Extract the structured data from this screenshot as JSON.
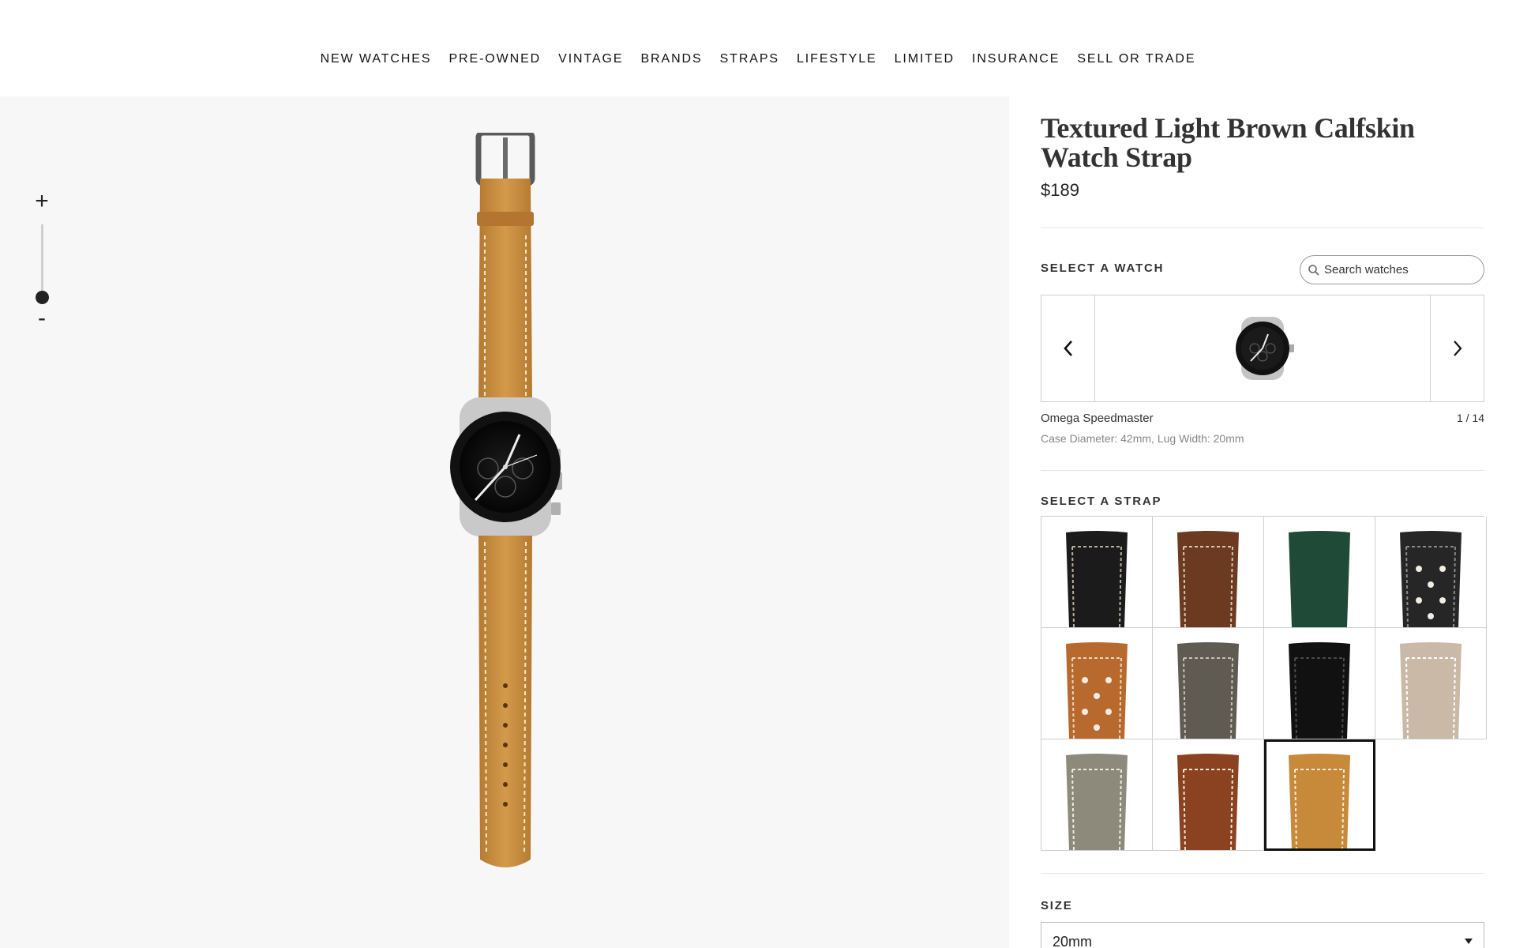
{
  "nav": {
    "items": [
      "NEW WATCHES",
      "PRE-OWNED",
      "VINTAGE",
      "BRANDS",
      "STRAPS",
      "LIFESTYLE",
      "LIMITED",
      "INSURANCE",
      "SELL OR TRADE"
    ]
  },
  "gallery": {
    "zoom_in_label": "+",
    "zoom_out_label": "-",
    "zoom_level": 0,
    "main_image": "omega-speedmaster-light-brown-strap"
  },
  "product": {
    "title": "Textured Light Brown Calfskin Watch Strap",
    "price": "$189"
  },
  "watch_selector": {
    "label": "SELECT A WATCH",
    "search_placeholder": "Search watches",
    "selected_name": "Omega Speedmaster",
    "position": "1 / 14",
    "specs": "Case Diameter: 42mm, Lug Width: 20mm",
    "prev_icon": "chevron-left-icon",
    "next_icon": "chevron-right-icon"
  },
  "strap_selector": {
    "label": "SELECT A STRAP",
    "straps": [
      {
        "name": "black-leather-strap",
        "color": "#1b1b1b",
        "stitch": "#b8b0a0",
        "perforated": false
      },
      {
        "name": "brown-leather-strap",
        "color": "#6b3a20",
        "stitch": "#d9c7b0",
        "perforated": false
      },
      {
        "name": "green-leather-strap",
        "color": "#1f4a37",
        "stitch": "#1f4a37",
        "perforated": false
      },
      {
        "name": "black-rally-strap",
        "color": "#262626",
        "stitch": "#8a8a8a",
        "perforated": true
      },
      {
        "name": "tan-rally-strap",
        "color": "#b86a2e",
        "stitch": "#e8d8c0",
        "perforated": true
      },
      {
        "name": "grey-suede-strap",
        "color": "#5f5a52",
        "stitch": "#c8c0b0",
        "perforated": false
      },
      {
        "name": "black-alligator-strap",
        "color": "#111111",
        "stitch": "#4a4a4a",
        "perforated": false
      },
      {
        "name": "sand-suede-strap",
        "color": "#cbb9a8",
        "stitch": "#ffffff",
        "perforated": false
      },
      {
        "name": "grey-vintage-strap",
        "color": "#8d8a7c",
        "stitch": "#f0ece0",
        "perforated": false
      },
      {
        "name": "rust-brown-strap",
        "color": "#8a4220",
        "stitch": "#f0e6d8",
        "perforated": false
      },
      {
        "name": "light-brown-calfskin-strap",
        "color": "#c68a3a",
        "stitch": "#f6ecd8",
        "perforated": false
      }
    ],
    "selected_index": 10
  },
  "size": {
    "label": "SIZE",
    "value": "20mm"
  }
}
